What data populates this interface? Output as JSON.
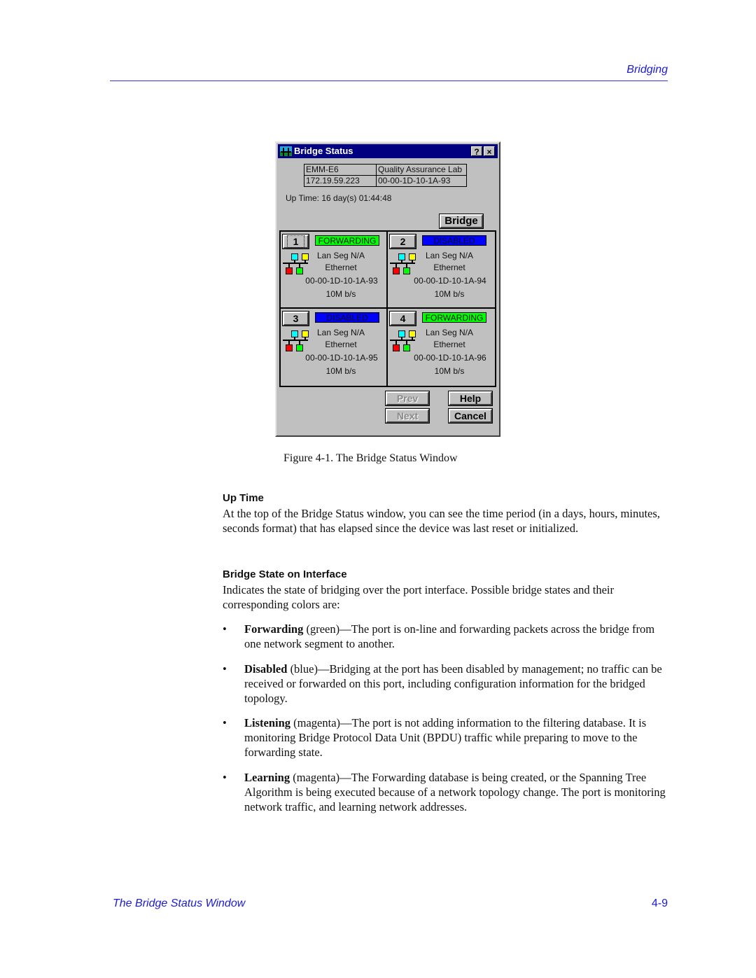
{
  "running_head": "Bridging",
  "dialog": {
    "title": "Bridge Status",
    "help_button": "?",
    "close_button": "×",
    "device_name": "EMM-E6",
    "location": "Quality Assurance Lab",
    "ip_address": "172.19.59.223",
    "mac_address": "00-00-1D-10-1A-93",
    "uptime": "Up Time: 16 day(s) 01:44:48",
    "bridge_button": "Bridge",
    "ports": [
      {
        "number": "1",
        "state": "FORWARDING",
        "state_color": "#00ff00",
        "lan_seg": "Lan Seg N/A",
        "type": "Ethernet",
        "mac": "00-00-1D-10-1A-93",
        "speed": "10M b/s"
      },
      {
        "number": "2",
        "state": "DISABLED",
        "state_color": "#0000ff",
        "lan_seg": "Lan Seg N/A",
        "type": "Ethernet",
        "mac": "00-00-1D-10-1A-94",
        "speed": "10M b/s"
      },
      {
        "number": "3",
        "state": "DISABLED",
        "state_color": "#0000ff",
        "lan_seg": "Lan Seg N/A",
        "type": "Ethernet",
        "mac": "00-00-1D-10-1A-95",
        "speed": "10M b/s"
      },
      {
        "number": "4",
        "state": "FORWARDING",
        "state_color": "#00ff00",
        "lan_seg": "Lan Seg N/A",
        "type": "Ethernet",
        "mac": "00-00-1D-10-1A-96",
        "speed": "10M b/s"
      }
    ],
    "prev_button": "Prev",
    "next_button": "Next",
    "help_label": "Help",
    "cancel_button": "Cancel"
  },
  "caption": "Figure 4-1.  The Bridge Status Window",
  "sections": {
    "uptime": {
      "heading": "Up Time",
      "body": "At the top of the Bridge Status window, you can see the time period (in a days, hours, minutes, seconds format) that has elapsed since the device was last reset or initialized."
    },
    "bridge_state": {
      "heading": "Bridge State on Interface",
      "body": "Indicates the state of bridging over the port interface. Possible bridge states and their corresponding colors are:",
      "bullets": [
        {
          "term": "Forwarding",
          "text": " (green)—The port is on-line and forwarding packets across the bridge from one network segment to another."
        },
        {
          "term": "Disabled",
          "text": " (blue)—Bridging at the port has been disabled by management; no traffic can be received or forwarded on this port, including configuration information for the bridged topology."
        },
        {
          "term": "Listening",
          "text": " (magenta)—The port is not adding information to the filtering database. It is monitoring Bridge Protocol Data Unit (BPDU) traffic while preparing to move to the forwarding state."
        },
        {
          "term": "Learning",
          "text": " (magenta)—The Forwarding database is being created, or the Spanning Tree Algorithm is being executed because of a network topology change. The port is monitoring network traffic, and learning network addresses."
        }
      ]
    }
  },
  "footer": {
    "title": "The Bridge Status Window",
    "page": "4-9"
  }
}
